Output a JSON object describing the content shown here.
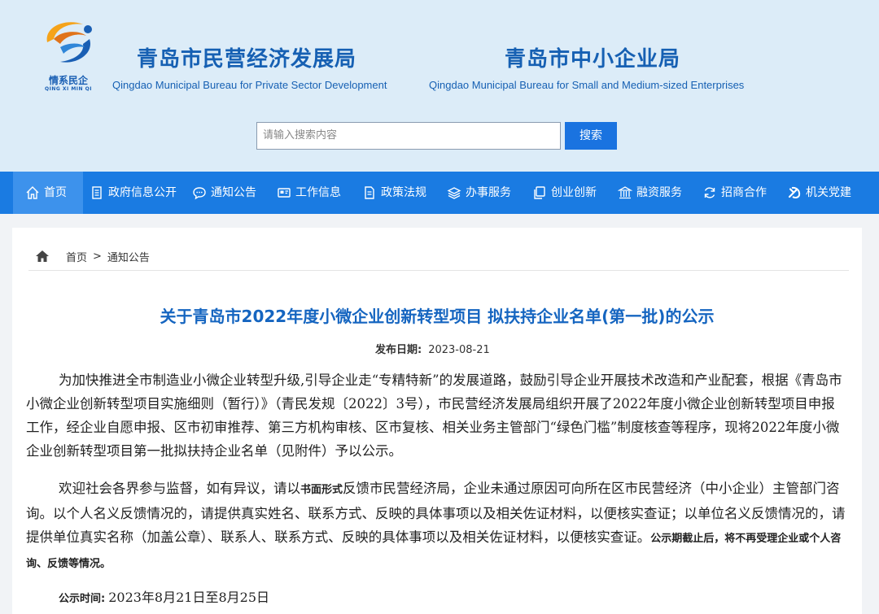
{
  "logo": {
    "text_cn": "情系民企",
    "text_en": "QING XI MIN QI"
  },
  "bureaus": [
    {
      "name_cn": "青岛市民营经济发展局",
      "name_en": "Qingdao Municipal Bureau for Private Sector Development"
    },
    {
      "name_cn": "青岛市中小企业局",
      "name_en": "Qingdao Municipal Bureau for Small and Medium-sized Enterprises"
    }
  ],
  "search": {
    "placeholder": "请输入搜索内容",
    "button": "搜索"
  },
  "nav": {
    "items": [
      {
        "label": "首页",
        "icon": "home-icon",
        "active": true
      },
      {
        "label": "政府信息公开",
        "icon": "document-icon"
      },
      {
        "label": "通知公告",
        "icon": "chat-icon"
      },
      {
        "label": "工作信息",
        "icon": "id-card-icon"
      },
      {
        "label": "政策法规",
        "icon": "file-icon"
      },
      {
        "label": "办事服务",
        "icon": "layers-icon"
      },
      {
        "label": "创业创新",
        "icon": "copy-icon"
      },
      {
        "label": "融资服务",
        "icon": "bank-icon"
      },
      {
        "label": "招商合作",
        "icon": "refresh-icon"
      },
      {
        "label": "机关党建",
        "icon": "party-emblem-icon"
      }
    ]
  },
  "breadcrumb": {
    "home": "首页",
    "separator": ">",
    "current": "通知公告"
  },
  "article": {
    "title": "关于青岛市2022年度小微企业创新转型项目 拟扶持企业名单(第一批)的公示",
    "date_label": "发布日期:",
    "date": "2023-08-21",
    "para1": "为加快推进全市制造业小微企业转型升级,引导企业走“专精特新”的发展道路，鼓励引导企业开展技术改造和产业配套，根据《青岛市小微企业创新转型项目实施细则（暂行）》（青民发规〔2022〕3号），市民营经济发展局组织开展了2022年度小微企业创新转型项目申报工作，经企业自愿申报、区市初审推荐、第三方机构审核、区市复核、相关业务主管部门“绿色门槛”制度核查等程序，现将2022年度小微企业创新转型项目第一批拟扶持企业名单（见附件）予以公示。",
    "para2_a": "欢迎社会各界参与监督，如有异议，请以",
    "para2_b": "书面形式",
    "para2_c": "反馈市民营经济局，企业未通过原因可向所在区市民营经济（中小企业）主管部门咨询。以个人名义反馈情况的，请提供真实姓名、联系方式、反映的具体事项以及相关佐证材料，以便核实查证；以单位名义反馈情况的，请提供单位真实名称（加盖公章）、联系人、联系方式、反映的具体事项以及相关佐证材料，以便核实查证。",
    "para2_d": "公示期截止后，将不再受理企业或个人咨询、反馈等情况。",
    "notice_label": "公示时间:",
    "notice_value": "2023年8月21日至8月25日"
  },
  "colors": {
    "nav_bg": "#1a7be2",
    "header_bg": "#dcecf8",
    "title_blue": "#1565c0",
    "button_blue": "#1a73e0"
  }
}
